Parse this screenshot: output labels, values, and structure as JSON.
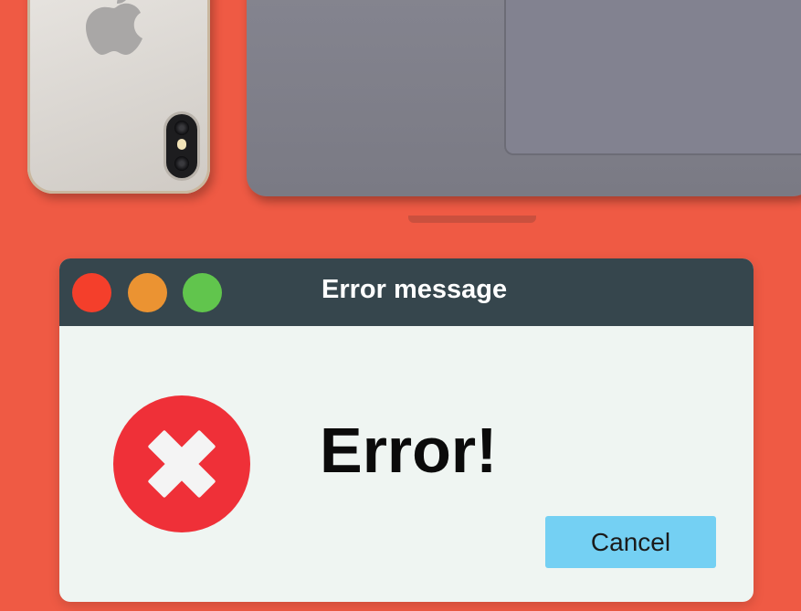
{
  "window": {
    "title": "Error message",
    "heading": "Error!",
    "cancel_label": "Cancel"
  },
  "icons": {
    "error": "close-x-circle-icon",
    "phone_logo": "apple-logo-icon"
  },
  "colors": {
    "background": "#ef5a44",
    "titlebar": "#36464d",
    "window_body": "#eff5f2",
    "close_dot": "#f43f2b",
    "minimize_dot": "#eb9332",
    "maximize_dot": "#61c54d",
    "error_icon": "#ef3038",
    "cancel_button": "#74d0f3"
  }
}
